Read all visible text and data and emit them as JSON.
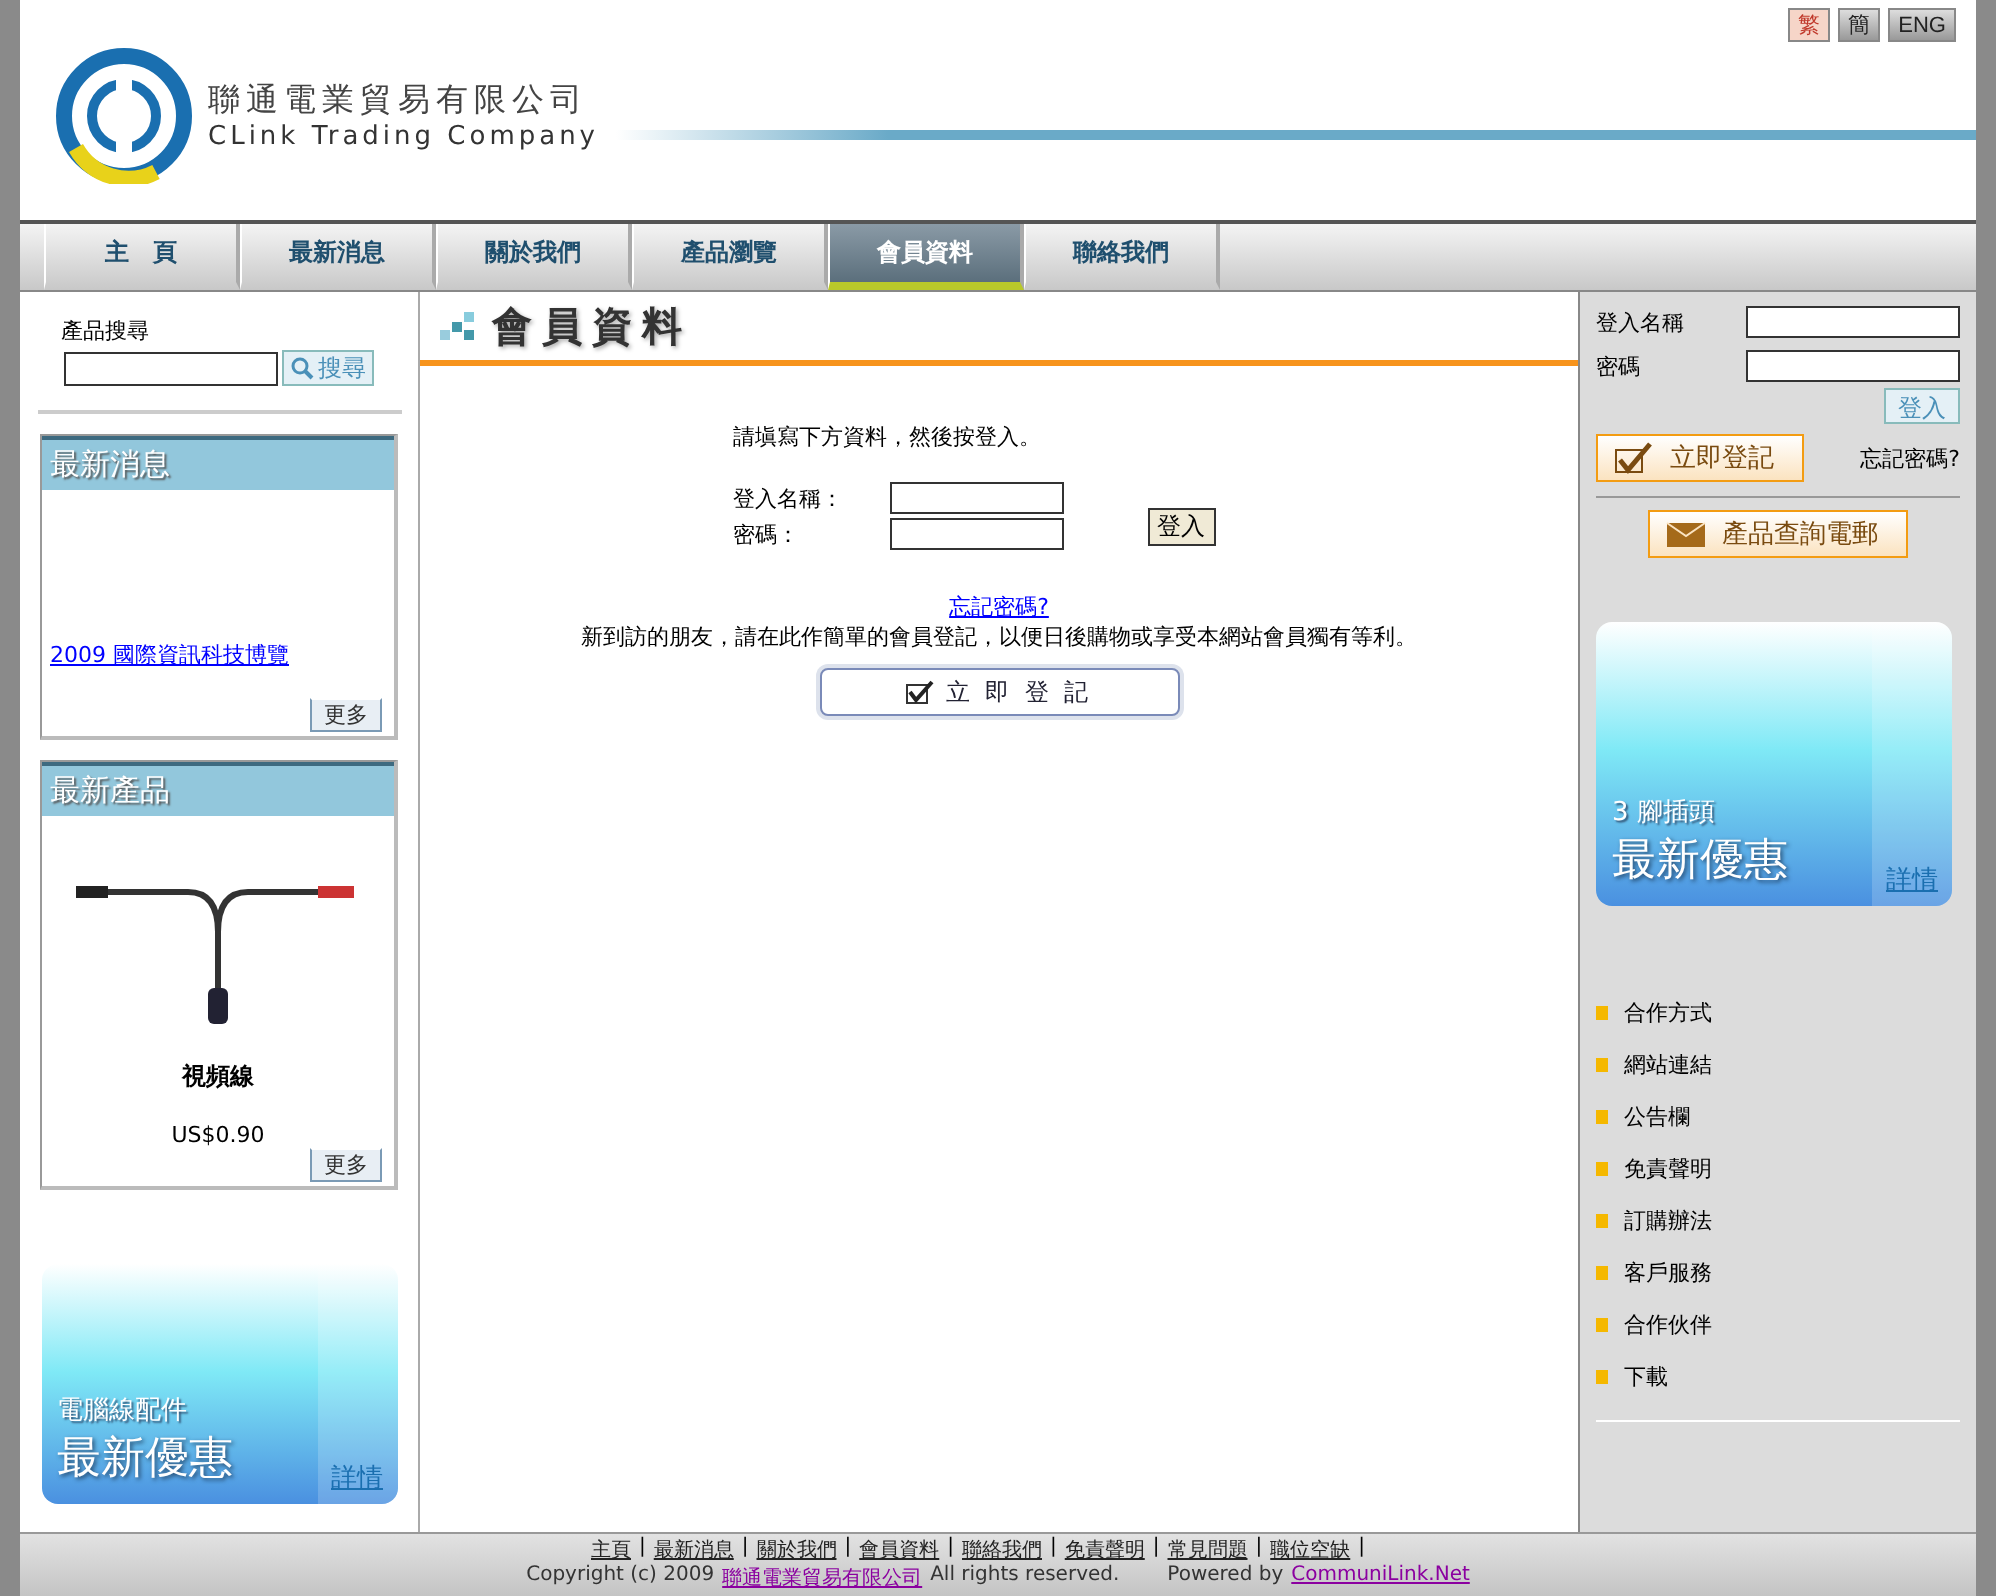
{
  "languages": [
    {
      "label": "繁",
      "selected": true
    },
    {
      "label": "簡",
      "selected": false
    },
    {
      "label": "ENG",
      "selected": false
    }
  ],
  "logo": {
    "name_zh": "聯通電業貿易有限公司",
    "name_en": "CLink Trading Company"
  },
  "nav": [
    {
      "label": "主　頁",
      "selected": false
    },
    {
      "label": "最新消息",
      "selected": false
    },
    {
      "label": "關於我們",
      "selected": false
    },
    {
      "label": "產品瀏覽",
      "selected": false
    },
    {
      "label": "會員資料",
      "selected": true
    },
    {
      "label": "聯絡我們",
      "selected": false
    }
  ],
  "left": {
    "search": {
      "label": "產品搜尋",
      "button": "搜尋"
    },
    "news": {
      "title": "最新消息",
      "link": "2009 國際資訊科技博覽",
      "more": "更多"
    },
    "products": {
      "title": "最新產品",
      "name": "視頻線",
      "price": "US$0.90",
      "more": "更多"
    },
    "promo": {
      "subtitle": "電腦線配件",
      "title": "最新優惠",
      "detail": "詳情"
    }
  },
  "main": {
    "title": "會員資料",
    "intro": "請塡寫下方資料，然後按登入。",
    "fields": [
      {
        "label": "登入名稱："
      },
      {
        "label": "密碼："
      }
    ],
    "login": "登入",
    "forgot": "忘記密碼?",
    "note": "新到訪的朋友，請在此作簡單的會員登記，以便日後購物或享受本網站會員獨有等利。",
    "register": "立 即 登 記"
  },
  "right": {
    "fields": [
      {
        "label": "登入名稱"
      },
      {
        "label": "密碼"
      }
    ],
    "login": "登入",
    "register": "立即登記",
    "forgot": "忘記密碼?",
    "enquiry": "產品查詢電郵",
    "promo": {
      "subtitle": "3 腳插頭",
      "title": "最新優惠",
      "detail": "詳情"
    },
    "links": [
      "合作方式",
      "網站連結",
      "公告欄",
      "免責聲明",
      "訂購辦法",
      "客戶服務",
      "合作伙伴",
      "下載"
    ]
  },
  "footer": {
    "links": [
      {
        "label": "主頁",
        "separator": "|"
      },
      {
        "label": "最新消息",
        "separator": "|"
      },
      {
        "label": "關於我們",
        "separator": "|"
      },
      {
        "label": "會員資料",
        "separator": "|"
      },
      {
        "label": "聯絡我們",
        "separator": "|"
      },
      {
        "label": "免責聲明",
        "separator": "|"
      },
      {
        "label": "常見問題",
        "separator": "|"
      },
      {
        "label": "職位空缺",
        "separator": "|"
      }
    ],
    "copyright": "Copyright (c) 2009",
    "company": "聯通電業貿易有限公司",
    "rights": "All rights reserved.",
    "powered": "Powered by",
    "vendor": "CommuniLink.Net"
  }
}
